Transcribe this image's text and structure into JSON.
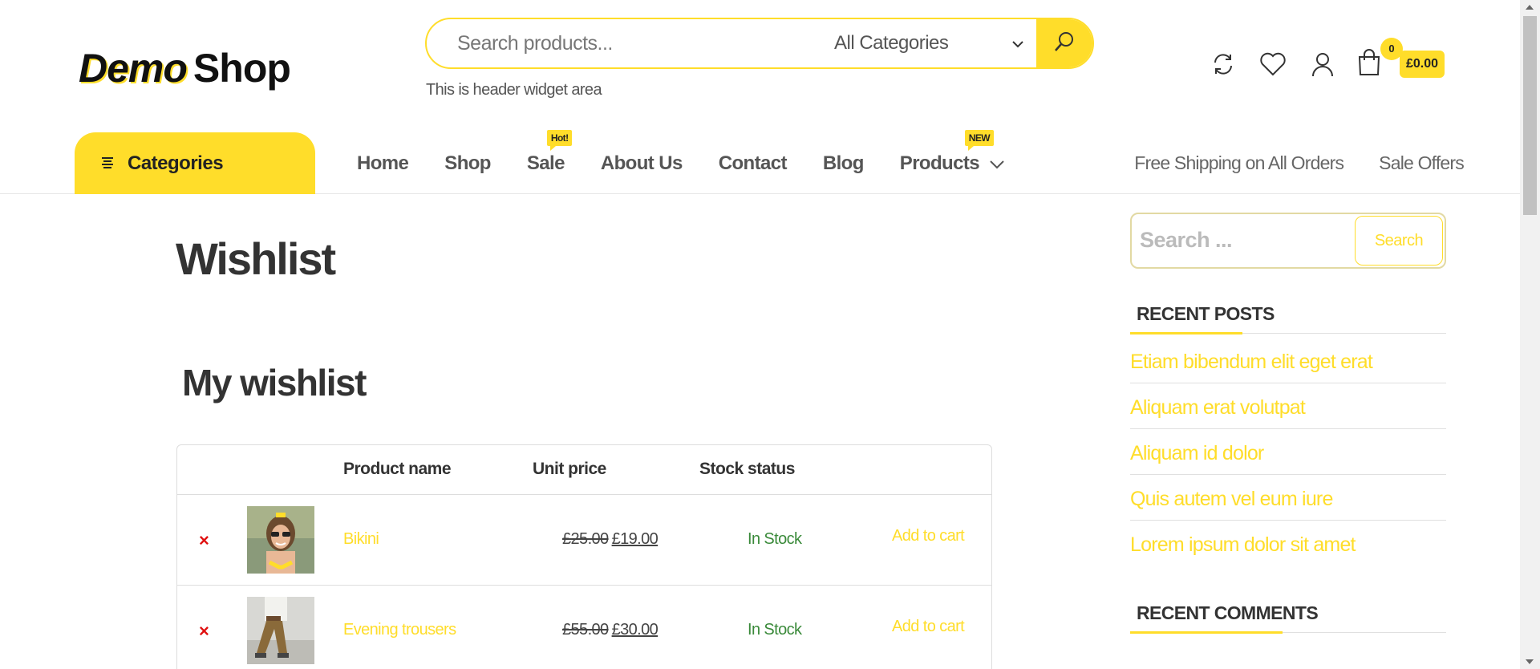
{
  "header": {
    "logo": {
      "demo": "Demo",
      "shop": "Shop"
    },
    "search": {
      "placeholder": "Search products...",
      "category": "All Categories"
    },
    "widget_text": "This is header widget area",
    "cart": {
      "count": "0",
      "total": "£0.00"
    },
    "icons": [
      "compare-icon",
      "heart-icon",
      "user-icon",
      "cart-icon"
    ]
  },
  "nav": {
    "categories_label": "Categories",
    "items": [
      {
        "label": "Home"
      },
      {
        "label": "Shop"
      },
      {
        "label": "Sale",
        "badge": "Hot!"
      },
      {
        "label": "About Us"
      },
      {
        "label": "Contact"
      },
      {
        "label": "Blog"
      },
      {
        "label": "Products",
        "badge": "NEW"
      }
    ],
    "right": [
      "Free Shipping on All Orders",
      "Sale Offers"
    ]
  },
  "main": {
    "page_title": "Wishlist",
    "section_title": "My wishlist",
    "table": {
      "headers": {
        "name": "Product name",
        "price": "Unit price",
        "stock": "Stock status"
      },
      "rows": [
        {
          "remove": "×",
          "name": "Bikini",
          "old_price": "£25.00",
          "price": "£19.00",
          "stock": "In Stock",
          "action": "Add to cart"
        },
        {
          "remove": "×",
          "name": "Evening trousers",
          "old_price": "£55.00",
          "price": "£30.00",
          "stock": "In Stock",
          "action": "Add to cart"
        }
      ]
    }
  },
  "sidebar": {
    "search": {
      "placeholder": "Search ...",
      "button": "Search"
    },
    "recent_posts_title": "RECENT POSTS",
    "recent_posts": [
      "Etiam bibendum elit eget erat",
      "Aliquam erat volutpat",
      "Aliquam id dolor",
      "Quis autem vel eum iure",
      "Lorem ipsum dolor sit amet"
    ],
    "recent_comments_title": "RECENT COMMENTS"
  },
  "colors": {
    "accent": "#ffdd2a",
    "remove": "#e01010",
    "stock": "#3a8a3a"
  }
}
